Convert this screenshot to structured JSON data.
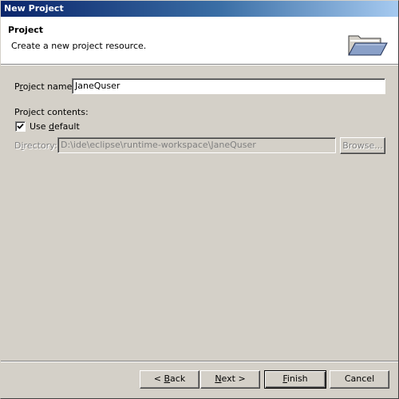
{
  "window": {
    "title": "New Project"
  },
  "banner": {
    "title": "Project",
    "description": "Create a new project resource.",
    "icon": "folder-icon"
  },
  "form": {
    "project_name_label_prefix": "P",
    "project_name_label_mnemonic": "r",
    "project_name_label_rest": "oject name:",
    "project_name_value": "JaneQuser",
    "project_contents_label": "Project contents:",
    "use_default_label_prefix": "Use ",
    "use_default_label_mnemonic": "d",
    "use_default_label_rest": "efault",
    "use_default_checked": true,
    "directory_label_prefix": "D",
    "directory_label_mnemonic": "i",
    "directory_label_rest": "rectory:",
    "directory_value": "D:\\ide\\eclipse\\runtime-workspace\\JaneQuser",
    "browse_label": "Browse..."
  },
  "footer": {
    "back_prefix": "< ",
    "back_mnemonic": "B",
    "back_rest": "ack",
    "next_mnemonic": "N",
    "next_rest": "ext >",
    "finish_mnemonic": "F",
    "finish_rest": "inish",
    "cancel_label": "Cancel"
  }
}
